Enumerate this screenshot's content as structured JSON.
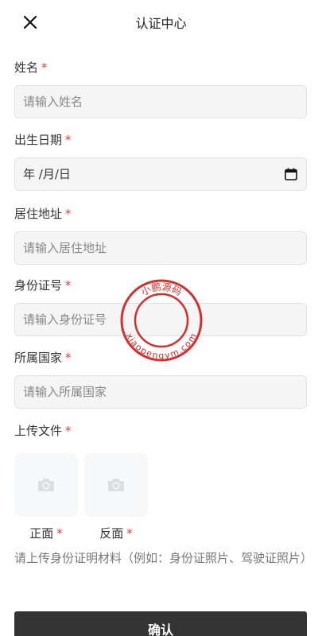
{
  "header": {
    "title": "认证中心"
  },
  "fields": {
    "name": {
      "label": "姓名",
      "required_mark": "*",
      "placeholder": "请输入姓名"
    },
    "birth": {
      "label": "出生日期",
      "required_mark": "*",
      "value": "年 /月/日"
    },
    "address": {
      "label": "居住地址",
      "required_mark": "*",
      "placeholder": "请输入居住地址"
    },
    "id": {
      "label": "身份证号",
      "required_mark": "*",
      "placeholder": "请输入身份证号"
    },
    "country": {
      "label": "所属国家",
      "required_mark": "*",
      "placeholder": "请输入所属国家"
    }
  },
  "upload": {
    "label": "上传文件",
    "required_mark": "*",
    "front_label": "正面",
    "back_label": "反面",
    "hint": "请上传身份证明材料（例如：身份证照片、驾驶证照片）"
  },
  "confirm_label": "确认",
  "watermark": {
    "top_text": "小鹏源码",
    "bottom_text": "xiaopengym.com",
    "color": "#d32f2f"
  }
}
